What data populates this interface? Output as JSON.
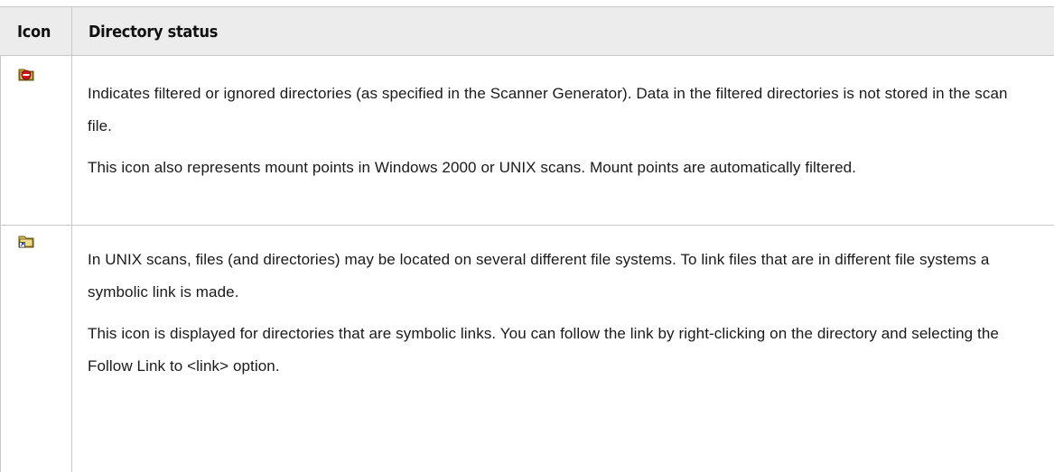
{
  "table": {
    "headers": {
      "icon": "Icon",
      "status": "Directory status"
    },
    "rows": [
      {
        "icon": "filtered-directory-icon",
        "paragraphs": [
          "Indicates filtered or ignored directories (as specified in the Scanner Generator). Data in the filtered directories is not stored in the scan file.",
          "This icon also represents mount points in Windows 2000 or UNIX scans. Mount points are automatically filtered."
        ]
      },
      {
        "icon": "symbolic-link-directory-icon",
        "paragraphs": [
          "In UNIX scans, files (and directories) may be located on several different file systems. To link files that are in different file systems a symbolic link is made.",
          "This icon is displayed for directories that are symbolic links. You can follow the link by right-clicking on the directory and selecting the Follow Link to <link> option."
        ]
      }
    ]
  }
}
